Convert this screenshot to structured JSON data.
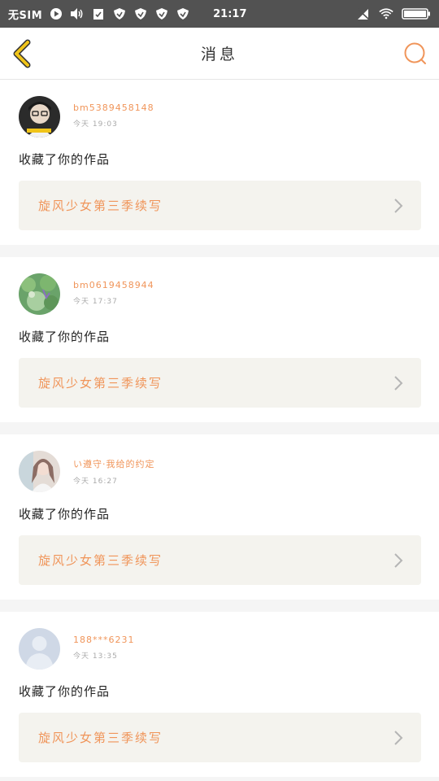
{
  "status_bar": {
    "sim": "无SIM",
    "time": "21:17"
  },
  "header": {
    "title": "消息"
  },
  "messages": [
    {
      "username": "bm5389458148",
      "timestamp": "今天 19:03",
      "action": "收藏了你的作品",
      "work_title": "旋风少女第三季续写",
      "avatar_icon": "avatar-photo-boy"
    },
    {
      "username": "bm0619458944",
      "timestamp": "今天 17:37",
      "action": "收藏了你的作品",
      "work_title": "旋风少女第三季续写",
      "avatar_icon": "avatar-photo-green"
    },
    {
      "username": "い遵守·我给的约定",
      "timestamp": "今天 16:27",
      "action": "收藏了你的作品",
      "work_title": "旋风少女第三季续写",
      "avatar_icon": "avatar-photo-girl"
    },
    {
      "username": "188***6231",
      "timestamp": "今天 13:35",
      "action": "收藏了你的作品",
      "work_title": "旋风少女第三季续写",
      "avatar_icon": "avatar-default"
    }
  ],
  "colors": {
    "accent": "#f0955a",
    "back_arrow": "#f0c419",
    "status_bar": "#525252",
    "work_box_bg": "#f4f3ee"
  }
}
